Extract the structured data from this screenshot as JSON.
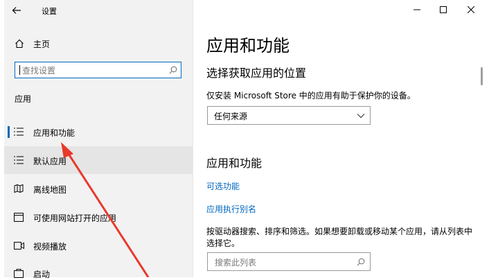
{
  "window": {
    "title": "设置",
    "controls": [
      "minimize",
      "maximize",
      "close"
    ]
  },
  "sidebar": {
    "home_label": "主页",
    "search_placeholder": "查找设置",
    "section_title": "应用",
    "items": [
      {
        "label": "应用和功能",
        "icon": "list-icon",
        "selected": true
      },
      {
        "label": "默认应用",
        "icon": "list-icon",
        "selected": false
      },
      {
        "label": "离线地图",
        "icon": "map-icon",
        "selected": false
      },
      {
        "label": "可使用网站打开的应用",
        "icon": "browser-window-icon",
        "selected": false
      },
      {
        "label": "视频播放",
        "icon": "video-icon",
        "selected": false
      },
      {
        "label": "启动",
        "icon": "startup-icon",
        "selected": false
      }
    ]
  },
  "main": {
    "page_title": "应用和功能",
    "install_section": {
      "heading": "选择获取应用的位置",
      "description": "仅安装 Microsoft Store 中的应用有助于保护你的设备。",
      "dropdown_value": "任何来源"
    },
    "apps_section": {
      "heading": "应用和功能",
      "links": [
        "可选功能",
        "应用执行别名"
      ],
      "description": "按驱动器搜索、排序和筛选。如果想要卸载或移动某个应用，请从列表中选择它。",
      "search_placeholder": "搜索此列表"
    }
  },
  "colors": {
    "accent": "#0067c0",
    "annotation_arrow": "#e8392b",
    "sidebar_bg": "#f2f2f2"
  }
}
